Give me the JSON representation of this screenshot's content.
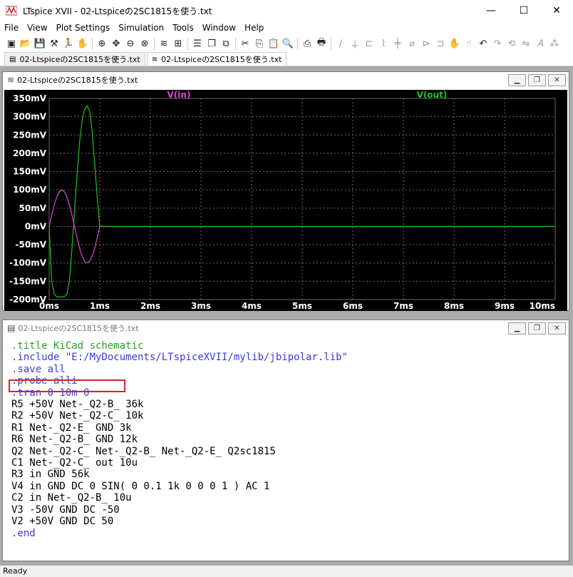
{
  "window": {
    "title": "LTspice XVII - 02-Ltspiceの2SC1815を使う.txt",
    "minimize": "—",
    "maximize": "☐",
    "close": "✕"
  },
  "menu": [
    "File",
    "View",
    "Plot Settings",
    "Simulation",
    "Tools",
    "Window",
    "Help"
  ],
  "toolbar_icons": [
    "run-icon",
    "open-icon",
    "save-icon",
    "control-panel-icon",
    "run-sim-icon",
    "halt-icon",
    "zoom-in-icon",
    "zoom-pan-icon",
    "zoom-out-icon",
    "zoom-cancel-icon",
    "autorange-icon",
    "plot-settings-icon",
    "tile-horizontal-icon",
    "cascade-icon",
    "tile-vertical-icon",
    "cut-icon",
    "copy-icon",
    "paste-icon",
    "find-icon",
    "print-setup-icon",
    "print-icon",
    "wire-icon",
    "ground-icon",
    "label-icon",
    "resistor-icon",
    "capacitor-icon",
    "inductor-icon",
    "diode-icon",
    "component-icon",
    "move-icon",
    "drag-icon",
    "undo-icon",
    "redo-icon",
    "rotate-icon",
    "mirror-icon",
    "text-icon",
    "spice-directive-icon"
  ],
  "tabs": [
    {
      "label": "02-Ltspiceの2SC1815を使う.txt",
      "active": false
    },
    {
      "label": "02-Ltspiceの2SC1815を使う.txt",
      "active": true
    }
  ],
  "waveform_window": {
    "title": "02-Ltspiceの2SC1815を使う.txt"
  },
  "netlist_window": {
    "title": "02-Ltspiceの2SC1815を使う.txt",
    "lines": [
      {
        "text": ".title KiCad schematic",
        "kind": "comment"
      },
      {
        "text": ".include \"E:/MyDocuments/LTspiceXVII/mylib/jbipolar.lib\"",
        "kind": "dir"
      },
      {
        "text": ".save all",
        "kind": "dir"
      },
      {
        "text": ".probe alli",
        "kind": "dir"
      },
      {
        "text": ".tran 0 10m 0",
        "kind": "dir"
      },
      {
        "text": "R5 +50V Net-_Q2-B_ 36k",
        "kind": "plain"
      },
      {
        "text": "R2 +50V Net-_Q2-C_ 10k",
        "kind": "plain"
      },
      {
        "text": "R1 Net-_Q2-E_ GND 3k",
        "kind": "plain"
      },
      {
        "text": "R6 Net-_Q2-B_ GND 12k",
        "kind": "plain"
      },
      {
        "text": "Q2 Net-_Q2-C_ Net-_Q2-B_ Net-_Q2-E_ Q2sc1815",
        "kind": "plain"
      },
      {
        "text": "C1 Net-_Q2-C_ out 10u",
        "kind": "plain"
      },
      {
        "text": "R3 in GND 56k",
        "kind": "plain"
      },
      {
        "text": "V4 in GND DC 0 SIN( 0 0.1 1k 0 0 0 1 ) AC 1",
        "kind": "plain"
      },
      {
        "text": "C2 in Net-_Q2-B_ 10u",
        "kind": "plain"
      },
      {
        "text": "V3 -50V GND DC -50",
        "kind": "plain"
      },
      {
        "text": "V2 +50V GND DC 50",
        "kind": "plain"
      },
      {
        "text": ".end",
        "kind": "dir"
      }
    ]
  },
  "status": "Ready",
  "colors": {
    "vin": "#e040e0",
    "vout": "#20c020",
    "grid": "#6a6a6a",
    "plot_bg": "#000000",
    "axis_text": "#ffffff"
  },
  "chart_data": {
    "type": "line",
    "x_unit": "ms",
    "xlim": [
      0,
      10
    ],
    "ylim": [
      -200,
      350
    ],
    "x_ticks": [
      0,
      1,
      2,
      3,
      4,
      5,
      6,
      7,
      8,
      9,
      10
    ],
    "x_tick_labels": [
      "0ms",
      "1ms",
      "2ms",
      "3ms",
      "4ms",
      "5ms",
      "6ms",
      "7ms",
      "8ms",
      "9ms",
      "10ms"
    ],
    "y_ticks": [
      350,
      300,
      250,
      200,
      150,
      100,
      50,
      0,
      -50,
      -100,
      -150,
      -200
    ],
    "y_tick_labels": [
      "350mV",
      "300mV",
      "250mV",
      "200mV",
      "150mV",
      "100mV",
      "50mV",
      "0mV",
      "-50mV",
      "-100mV",
      "-150mV",
      "-200mV"
    ],
    "series": [
      {
        "name": "V(in)",
        "color": "#e040e0",
        "x": [
          0,
          0.05,
          0.1,
          0.15,
          0.2,
          0.25,
          0.3,
          0.35,
          0.4,
          0.45,
          0.5,
          0.55,
          0.6,
          0.65,
          0.7,
          0.75,
          0.8,
          0.85,
          0.9,
          0.95,
          1.0,
          10
        ],
        "y": [
          0,
          31,
          59,
          81,
          95,
          100,
          95,
          81,
          59,
          31,
          0,
          -31,
          -59,
          -81,
          -95,
          -100,
          -95,
          -81,
          -59,
          -31,
          0,
          0
        ]
      },
      {
        "name": "V(out)",
        "color": "#20c020",
        "x": [
          0,
          0.05,
          0.1,
          0.15,
          0.2,
          0.25,
          0.3,
          0.35,
          0.4,
          0.45,
          0.5,
          0.55,
          0.6,
          0.65,
          0.7,
          0.75,
          0.8,
          0.85,
          0.9,
          0.95,
          1.0,
          10
        ],
        "y": [
          0,
          -150,
          -185,
          -192,
          -193,
          -193,
          -192,
          -185,
          -150,
          -60,
          40,
          140,
          230,
          290,
          320,
          330,
          315,
          260,
          170,
          80,
          0,
          0
        ]
      }
    ]
  }
}
